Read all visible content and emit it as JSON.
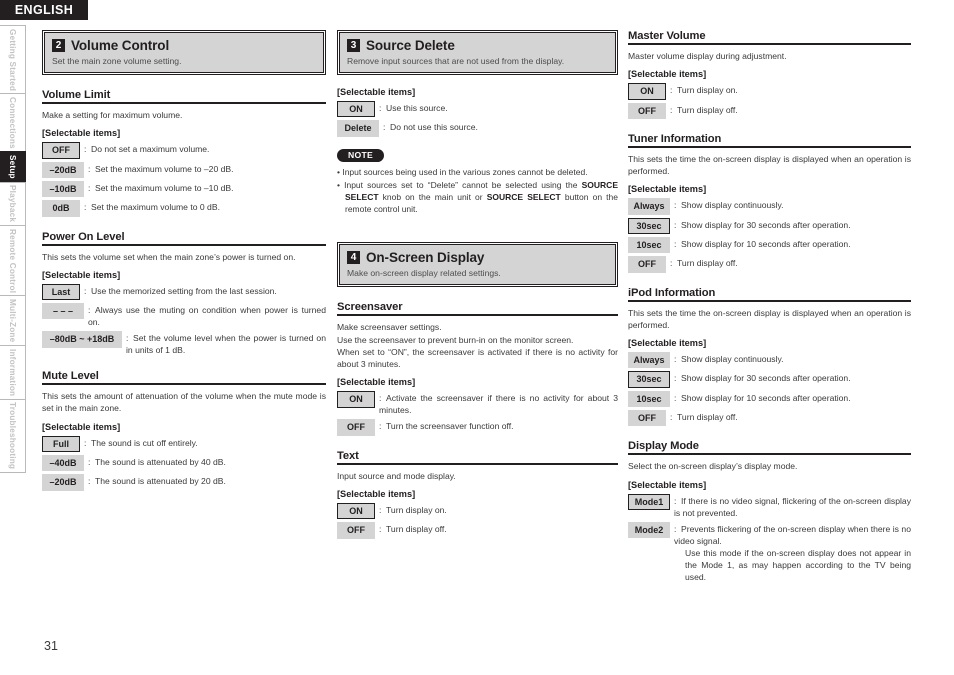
{
  "header": {
    "language": "ENGLISH"
  },
  "sidebar": {
    "items": [
      {
        "label": "Getting Started",
        "active": false
      },
      {
        "label": "Connections",
        "active": false
      },
      {
        "label": "Setup",
        "active": true
      },
      {
        "label": "Playback",
        "active": false
      },
      {
        "label": "Remote Control",
        "active": false
      },
      {
        "label": "Multi-Zone",
        "active": false
      },
      {
        "label": "Information",
        "active": false
      },
      {
        "label": "Troubleshooting",
        "active": false
      }
    ]
  },
  "footer": {
    "page_number": "31"
  },
  "column1": {
    "title_box": {
      "number": "2",
      "title": "Volume Control",
      "subtitle": "Set the main zone volume setting."
    },
    "sections": [
      {
        "heading": "Volume Limit",
        "description": "Make a setting for maximum volume.",
        "selectable_label": "[Selectable items]",
        "items": [
          {
            "badge": "OFF",
            "default": true,
            "desc": "Do not set a maximum volume."
          },
          {
            "badge": "–20dB",
            "default": false,
            "desc": "Set the maximum volume to –20 dB."
          },
          {
            "badge": "–10dB",
            "default": false,
            "desc": "Set the maximum volume to –10 dB."
          },
          {
            "badge": "0dB",
            "default": false,
            "desc": "Set the maximum volume to 0 dB."
          }
        ]
      },
      {
        "heading": "Power On Level",
        "description": "This sets the volume set when the main zone’s power is turned on.",
        "selectable_label": "[Selectable items]",
        "items": [
          {
            "badge": "Last",
            "default": true,
            "desc": "Use the memorized setting from the last session."
          },
          {
            "badge": "– – –",
            "default": false,
            "desc": "Always use the muting on condition when power is turned on."
          },
          {
            "badge": "–80dB ~ +18dB",
            "default": false,
            "desc": "Set the volume level when the power is turned on in units of 1 dB."
          }
        ]
      },
      {
        "heading": "Mute Level",
        "description": "This sets the amount of attenuation of the volume when the mute mode is set in the main zone.",
        "selectable_label": "[Selectable items]",
        "items": [
          {
            "badge": "Full",
            "default": true,
            "desc": "The sound is cut off entirely."
          },
          {
            "badge": "–40dB",
            "default": false,
            "desc": "The sound is attenuated by 40 dB."
          },
          {
            "badge": "–20dB",
            "default": false,
            "desc": "The sound is attenuated by 20 dB."
          }
        ]
      }
    ]
  },
  "column2": {
    "title_box_a": {
      "number": "3",
      "title": "Source Delete",
      "subtitle": "Remove input sources that are not used from the display."
    },
    "source_delete": {
      "selectable_label": "[Selectable items]",
      "items": [
        {
          "badge": "ON",
          "default": true,
          "desc": "Use this source."
        },
        {
          "badge": "Delete",
          "default": false,
          "desc": "Do not use this source."
        }
      ],
      "note_label": "NOTE",
      "notes": [
        "Input sources being used in the various zones cannot be deleted.",
        "Input sources set to “Delete” cannot be selected using the SOURCE SELECT knob on the main unit or SOURCE SELECT button on the remote control unit."
      ]
    },
    "title_box_b": {
      "number": "4",
      "title": "On-Screen Display",
      "subtitle": "Make on-screen display related settings."
    },
    "sections": [
      {
        "heading": "Screensaver",
        "description": "Make screensaver settings.\nUse the screensaver to prevent burn-in on the monitor screen.\nWhen set to “ON”, the screensaver is activated if there is no activity for about 3 minutes.",
        "selectable_label": "[Selectable items]",
        "items": [
          {
            "badge": "ON",
            "default": true,
            "desc": "Activate the screensaver if there is no activity for about 3 minutes."
          },
          {
            "badge": "OFF",
            "default": false,
            "desc": "Turn the screensaver function off."
          }
        ]
      },
      {
        "heading": "Text",
        "description": "Input source and mode display.",
        "selectable_label": "[Selectable items]",
        "items": [
          {
            "badge": "ON",
            "default": true,
            "desc": "Turn display on."
          },
          {
            "badge": "OFF",
            "default": false,
            "desc": "Turn display off."
          }
        ]
      }
    ]
  },
  "column3": {
    "sections": [
      {
        "heading": "Master Volume",
        "description": "Master volume display during adjustment.",
        "selectable_label": "[Selectable items]",
        "items": [
          {
            "badge": "ON",
            "default": true,
            "desc": "Turn display on."
          },
          {
            "badge": "OFF",
            "default": false,
            "desc": "Turn display off."
          }
        ]
      },
      {
        "heading": "Tuner Information",
        "description": "This sets the time the on-screen display is displayed when an operation is performed.",
        "selectable_label": "[Selectable items]",
        "items": [
          {
            "badge": "Always",
            "default": false,
            "desc": "Show display continuously."
          },
          {
            "badge": "30sec",
            "default": true,
            "desc": "Show display for 30 seconds after operation."
          },
          {
            "badge": "10sec",
            "default": false,
            "desc": "Show display for 10 seconds after operation."
          },
          {
            "badge": "OFF",
            "default": false,
            "desc": "Turn display off."
          }
        ]
      },
      {
        "heading": "iPod Information",
        "description": "This sets the time the on-screen display is displayed when an operation is performed.",
        "selectable_label": "[Selectable items]",
        "items": [
          {
            "badge": "Always",
            "default": false,
            "desc": "Show display continuously."
          },
          {
            "badge": "30sec",
            "default": true,
            "desc": "Show display for 30 seconds after operation."
          },
          {
            "badge": "10sec",
            "default": false,
            "desc": "Show display for 10 seconds after operation."
          },
          {
            "badge": "OFF",
            "default": false,
            "desc": "Turn display off."
          }
        ]
      },
      {
        "heading": "Display Mode",
        "description": "Select the on-screen display’s display mode.",
        "selectable_label": "[Selectable items]",
        "items": [
          {
            "badge": "Mode1",
            "default": true,
            "desc": "If there is no video signal, flickering of the on-screen display is not prevented."
          },
          {
            "badge": "Mode2",
            "default": false,
            "desc": "Prevents flickering of the on-screen display when there is no video signal.\nUse this mode if the on-screen display does not appear in the Mode 1, as may happen according to the TV being used."
          }
        ]
      }
    ]
  }
}
